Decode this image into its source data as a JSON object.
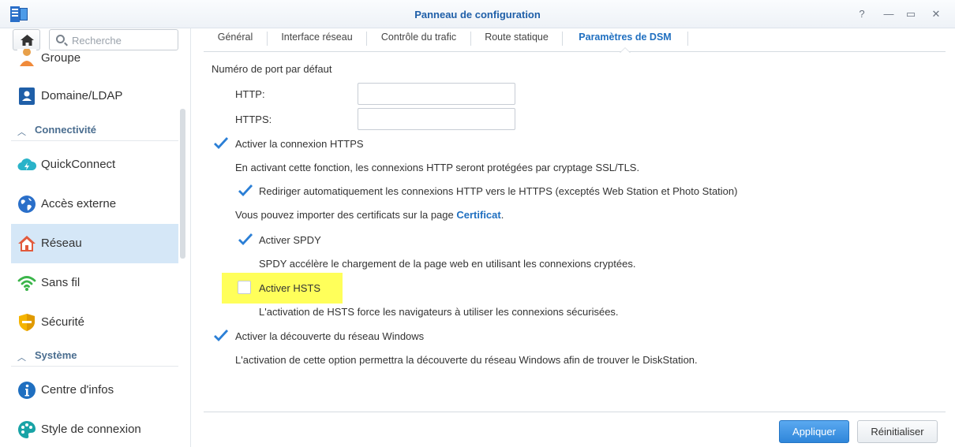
{
  "window": {
    "title": "Panneau de configuration",
    "controls": {
      "help": "?",
      "minimize": "—",
      "maximize": "▭",
      "close": "✕"
    }
  },
  "sidebar": {
    "search_placeholder": "Recherche",
    "items": [
      {
        "label": "Groupe",
        "icon": "group-icon"
      },
      {
        "label": "Domaine/LDAP",
        "icon": "domain-ldap-icon"
      },
      {
        "section": "Connectivité"
      },
      {
        "label": "QuickConnect",
        "icon": "quickconnect-icon"
      },
      {
        "label": "Accès externe",
        "icon": "globe-icon"
      },
      {
        "label": "Réseau",
        "icon": "network-house-icon",
        "active": true
      },
      {
        "label": "Sans fil",
        "icon": "wifi-icon"
      },
      {
        "label": "Sécurité",
        "icon": "shield-icon"
      },
      {
        "section": "Système"
      },
      {
        "label": "Centre d'infos",
        "icon": "info-icon"
      },
      {
        "label": "Style de connexion",
        "icon": "palette-icon"
      }
    ]
  },
  "tabs": [
    {
      "label": "Général"
    },
    {
      "label": "Interface réseau"
    },
    {
      "label": "Contrôle du trafic"
    },
    {
      "label": "Route statique"
    },
    {
      "label": "Paramètres de DSM",
      "active": true
    }
  ],
  "form": {
    "port_heading": "Numéro de port par défaut",
    "http_label": "HTTP:",
    "http_value": "",
    "https_label": "HTTPS:",
    "https_value": "",
    "enable_https": {
      "label": "Activer la connexion HTTPS",
      "checked": true
    },
    "https_desc": "En activant cette fonction, les connexions HTTP seront protégées par cryptage SSL/TLS.",
    "redirect_https": {
      "label": "Rediriger automatiquement les connexions HTTP vers le HTTPS (exceptés Web Station et Photo Station)",
      "checked": true
    },
    "cert_text": "Vous pouvez importer des certificats sur la page ",
    "cert_link": "Certificat",
    "cert_suffix": ".",
    "enable_spdy": {
      "label": "Activer SPDY",
      "checked": true
    },
    "spdy_desc": "SPDY accélère le chargement de la page web en utilisant les connexions cryptées.",
    "enable_hsts": {
      "label": "Activer HSTS",
      "checked": false
    },
    "hsts_desc": "L'activation de HSTS force les navigateurs à utiliser les connexions sécurisées.",
    "enable_windows_discovery": {
      "label": "Activer la découverte du réseau Windows",
      "checked": true
    },
    "windows_desc": "L'activation de cette option permettra la découverte du réseau Windows afin de trouver le DiskStation."
  },
  "footer": {
    "apply": "Appliquer",
    "reset": "Réinitialiser"
  },
  "colors": {
    "accent": "#1f6fc0",
    "checkmark": "#2b7fd6",
    "active_item_bg": "#d5e7f7",
    "highlight": "#ffff5a"
  }
}
